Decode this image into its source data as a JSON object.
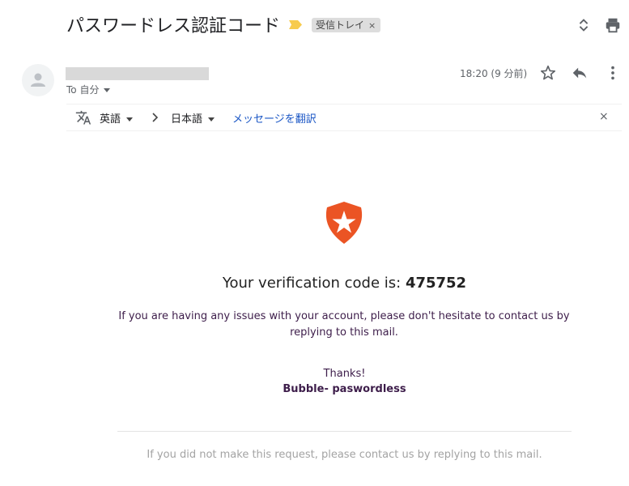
{
  "email": {
    "subject": "パスワードレス認証コード",
    "label": "受信トレイ",
    "label_close": "×",
    "recipient": "To 自分",
    "time": "18:20 (9 分前)"
  },
  "translate_bar": {
    "source_lang": "英語",
    "target_lang": "日本語",
    "action_link": "メッセージを翻訳",
    "close": "×"
  },
  "body": {
    "code_prefix": "Your verification code is: ",
    "code": "475752",
    "message": "If you are having any issues with your account, please don't hesitate to contact us by replying to this mail.",
    "thanks": "Thanks!",
    "signature": "Bubble- paswordless",
    "footer": "If you did not make this request, please contact us by replying to this mail."
  },
  "colors": {
    "brand_logo": "#eb5424",
    "link": "#1a56c5",
    "body_text": "#3d1d4a",
    "importance_marker": "#f7cb4d"
  },
  "icons": {
    "importance": "importance-marker-icon",
    "nav": "expand-collapse-icon",
    "print": "print-icon",
    "avatar": "person-icon",
    "star": "star-icon",
    "reply": "reply-icon",
    "more": "more-vert-icon",
    "translate": "translate-icon",
    "arrow": "chevron-right-icon",
    "brand": "auth0-shield-logo"
  }
}
